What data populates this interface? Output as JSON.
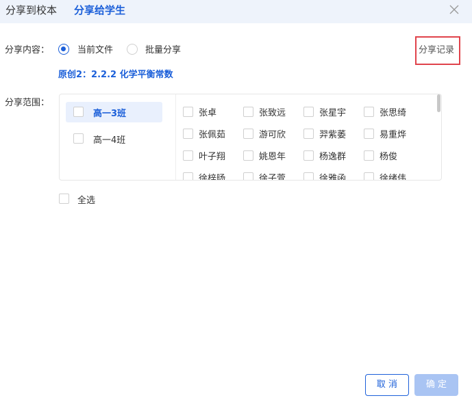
{
  "tabs": {
    "school_label": "分享到校本",
    "student_label": "分享给学生"
  },
  "content": {
    "label": "分享内容：",
    "options": [
      {
        "label": "当前文件",
        "checked": true
      },
      {
        "label": "批量分享",
        "checked": false
      }
    ],
    "file_name": "原创2：2.2.2 化学平衡常数",
    "record_link": "分享记录"
  },
  "scope": {
    "label": "分享范围：",
    "classes": [
      {
        "name": "高一3班",
        "selected": true,
        "checked": false
      },
      {
        "name": "高一4班",
        "selected": false,
        "checked": false
      }
    ],
    "students": [
      "张卓",
      "张致远",
      "张星宇",
      "张思绮",
      "张佩茹",
      "游可欣",
      "羿紫萎",
      "易重烨",
      "叶子翔",
      "姚恩年",
      "杨逸群",
      "杨俊",
      "徐梓旸",
      "徐子萱",
      "徐雅函",
      "徐绪伟"
    ],
    "select_all": "全选"
  },
  "footer": {
    "cancel_label": "取 消",
    "ok_label": "确 定"
  },
  "colors": {
    "accent": "#1b5fd9",
    "header_bg": "#eef3fb",
    "highlight_border": "#e0424a",
    "ok_disabled": "#a9c4f3"
  },
  "icons": {
    "close": "close-icon"
  }
}
